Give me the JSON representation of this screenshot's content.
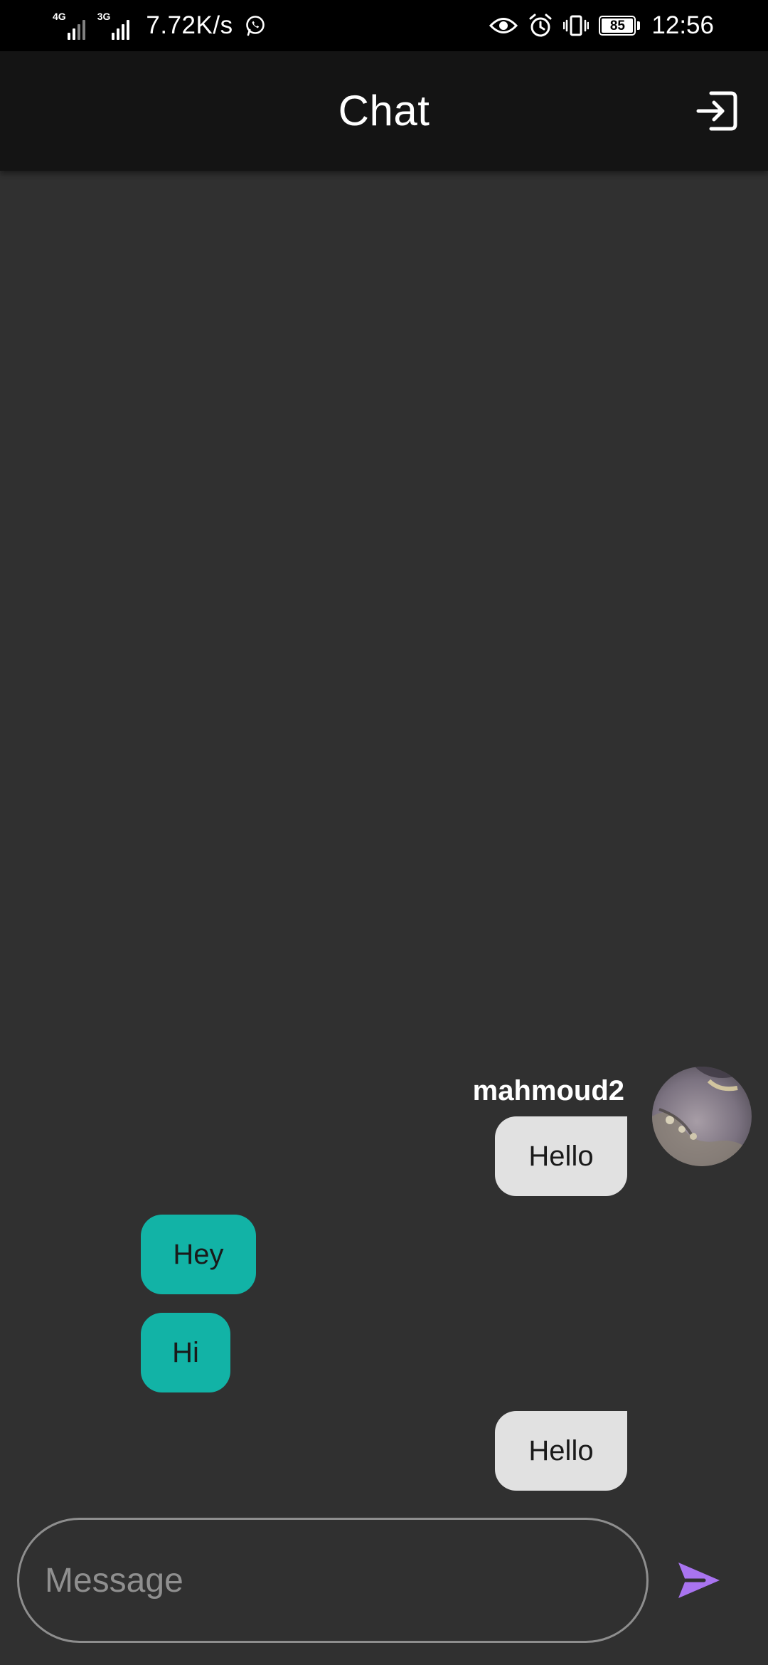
{
  "status_bar": {
    "network_1": "4G",
    "network_2": "3G",
    "speed": "7.72K/s",
    "battery": "85",
    "time": "12:56"
  },
  "app_bar": {
    "title": "Chat"
  },
  "messages": [
    {
      "side": "right",
      "sender": "mahmoud2",
      "text": "Hello"
    },
    {
      "side": "left",
      "text": "Hey"
    },
    {
      "side": "left",
      "text": "Hi"
    },
    {
      "side": "right",
      "text": "Hello"
    }
  ],
  "composer": {
    "placeholder": "Message"
  },
  "colors": {
    "background": "#303030",
    "app_bar": "#141414",
    "own_bubble": "#e1e1e1",
    "other_bubble": "#12b3a6",
    "send_accent": "#a974f0"
  },
  "icons": {
    "logout": "logout-icon",
    "send": "send-icon",
    "whatsapp": "whatsapp-icon",
    "eye": "eye-icon",
    "alarm": "alarm-icon",
    "vibrate": "vibrate-icon"
  }
}
